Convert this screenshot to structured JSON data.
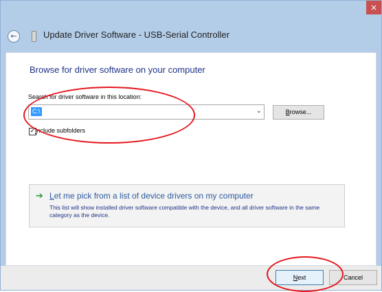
{
  "window": {
    "close_glyph": "×",
    "title": "Update Driver Software - USB-Serial Controller"
  },
  "header": {
    "back_glyph": "←"
  },
  "content": {
    "heading": "Browse for driver software on your computer",
    "search_label": "Search for driver software in this location:",
    "path_value": "C:\\",
    "dropdown_glyph": "⌄",
    "browse": {
      "pre": "",
      "underline": "B",
      "post": "rowse..."
    },
    "include_subfolders": {
      "checked": true,
      "check_glyph": "✓",
      "underline": "I",
      "post": "nclude subfolders"
    },
    "pick": {
      "arrow_glyph": "➔",
      "title": {
        "underline": "L",
        "post": "et me pick from a list of device drivers on my computer"
      },
      "description": "This list will show installed driver software compatible with the device, and all driver software in the same category as the device."
    }
  },
  "footer": {
    "next": {
      "underline": "N",
      "post": "ext"
    },
    "cancel": "Cancel"
  },
  "colors": {
    "title_bar": "#b3cde8",
    "close_button": "#c75050",
    "heading_text": "#1e3287",
    "link_text": "#2c5aa0",
    "selection": "#3399ff",
    "annotation": "#e4151c"
  },
  "icons": [
    "close-icon",
    "back-arrow-icon",
    "usb-device-icon",
    "chevron-down-icon",
    "checkmark-icon",
    "green-arrow-icon"
  ]
}
